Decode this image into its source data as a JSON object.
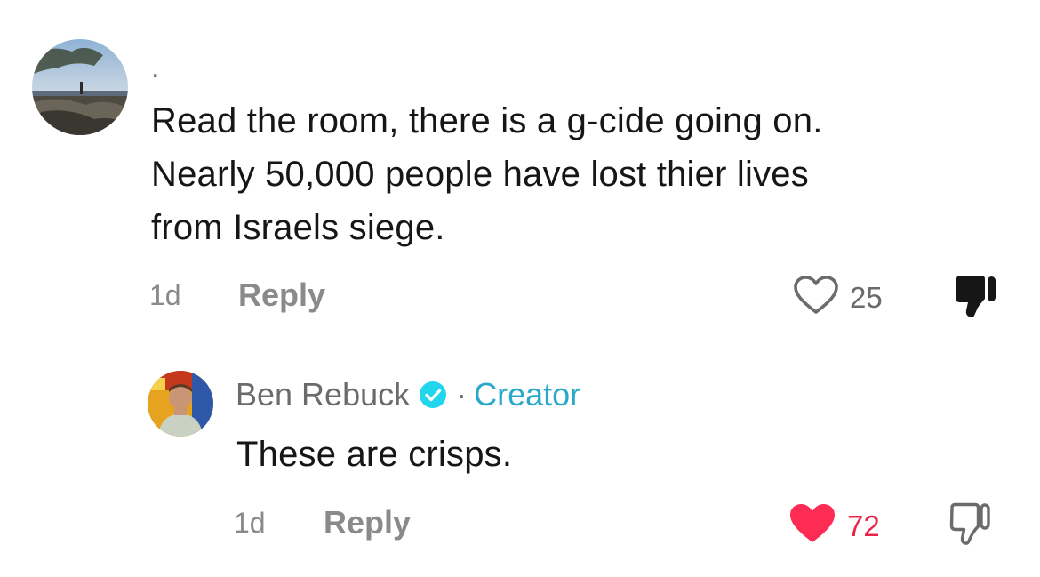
{
  "comments": [
    {
      "username": ".",
      "text_lines": [
        "Read the room, there is a g-cide going on.",
        "Nearly 50,000 people have lost thier lives",
        "from Israels siege."
      ],
      "time": "1d",
      "reply_label": "Reply",
      "likes": "25",
      "liked": false
    },
    {
      "username": "Ben Rebuck",
      "verified": true,
      "separator": "·",
      "role": "Creator",
      "text": "These are crisps.",
      "time": "1d",
      "reply_label": "Reply",
      "likes": "72",
      "liked": true
    }
  ],
  "colors": {
    "text": "#161616",
    "muted": "#8a8a8a",
    "creator": "#2aa8c7",
    "like_active": "#fe2c55"
  },
  "icons": [
    "heart-outline-icon",
    "heart-filled-icon",
    "thumbs-down-filled-icon",
    "thumbs-down-outline-icon",
    "verified-badge-icon"
  ]
}
